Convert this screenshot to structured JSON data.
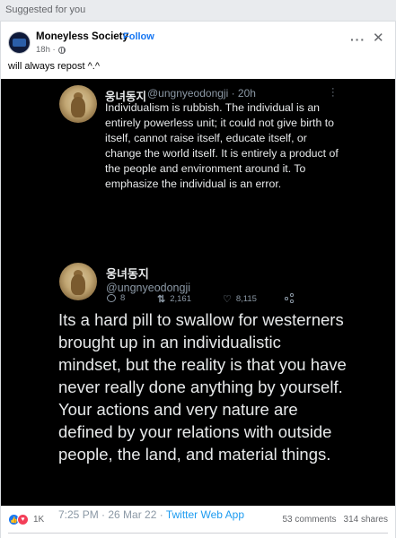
{
  "feed": {
    "suggested_label": "Suggested for you"
  },
  "post": {
    "page_name": "Moneyless Society",
    "separator": "·",
    "follow_label": "Follow",
    "time": "18h ·",
    "more_label": "···",
    "close_label": "✕",
    "caption": "will always repost ^.^"
  },
  "tweet_small": {
    "name": "웅녀동지",
    "handle_time": "@ungnyeodongji · 20h",
    "text": "Individualism is rubbish. The individual is an entirely powerless unit; it could not give birth to itself, cannot raise itself, educate itself, or change the world itself. It is entirely a product of the people and environment around it. To emphasize the individual is an error.",
    "reply_count": "8",
    "retweet_count": "2,161",
    "like_count": "8,115"
  },
  "tweet_large": {
    "name": "웅녀동지",
    "handle": "@ungnyeodongji",
    "text": "Its a hard pill to swallow for westerners brought up in an individualistic mindset, but the reality is that you have never really done anything by yourself. Your actions and very nature are defined by your relations with outside people, the land, and material things.",
    "timestamp": "7:25 PM · 26 Mar 22 · ",
    "source": "Twitter Web App"
  },
  "engagement": {
    "reaction_count": "1K",
    "comments": "53 comments",
    "shares": "314 shares"
  },
  "colors": {
    "facebook_blue": "#1877f2",
    "twitter_blue": "#1d9bf0",
    "media_bg": "#000000"
  }
}
